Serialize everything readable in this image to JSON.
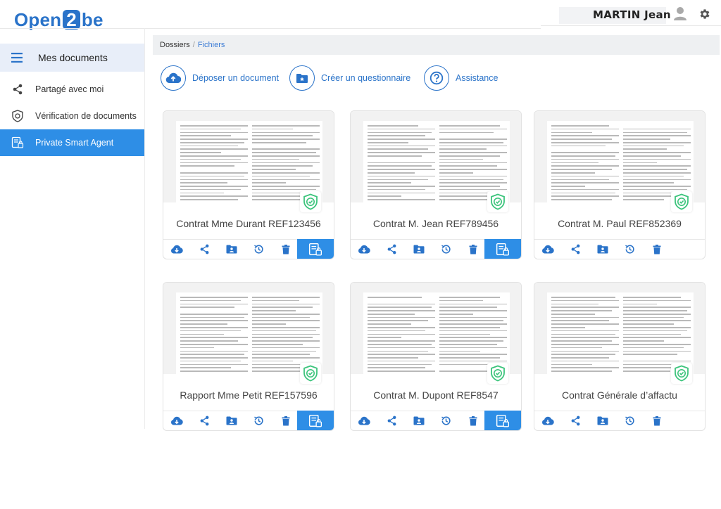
{
  "header": {
    "logo_part1": "Open",
    "logo_part2": "2",
    "logo_part3": "be",
    "user_name": "MARTIN Jean"
  },
  "sidebar": {
    "title": "Mes documents",
    "items": [
      {
        "label": "Partagé avec moi",
        "icon": "share-icon"
      },
      {
        "label": "Vérification de documents",
        "icon": "shield-icon"
      },
      {
        "label": "Private Smart Agent",
        "icon": "smart-agent-icon",
        "active": true
      }
    ]
  },
  "breadcrumb": {
    "root": "Dossiers",
    "separator": "/",
    "current": "Fichiers"
  },
  "actions": [
    {
      "label": "Déposer un document",
      "icon": "cloud-upload-icon"
    },
    {
      "label": "Créer un questionnaire",
      "icon": "folder-star-icon"
    },
    {
      "label": "Assistance",
      "icon": "help-icon"
    }
  ],
  "documents": [
    {
      "title": "Contrat Mme Durant REF123456",
      "smart_agent": true
    },
    {
      "title": "Contrat M. Jean REF789456",
      "smart_agent": true
    },
    {
      "title": "Contrat M. Paul REF852369",
      "smart_agent": false
    },
    {
      "title": "Rapport Mme Petit REF157596",
      "smart_agent": true
    },
    {
      "title": "Contrat M. Dupont REF8547",
      "smart_agent": true
    },
    {
      "title": "Contrat Générale d’affactu",
      "smart_agent": false
    }
  ],
  "card_toolbar_icons": [
    "download-icon",
    "share-icon",
    "folder-user-icon",
    "history-icon",
    "trash-icon",
    "smart-agent-icon"
  ],
  "colors": {
    "accent": "#2e8ee6",
    "brand": "#2a73c9",
    "verified": "#3cc47c"
  }
}
